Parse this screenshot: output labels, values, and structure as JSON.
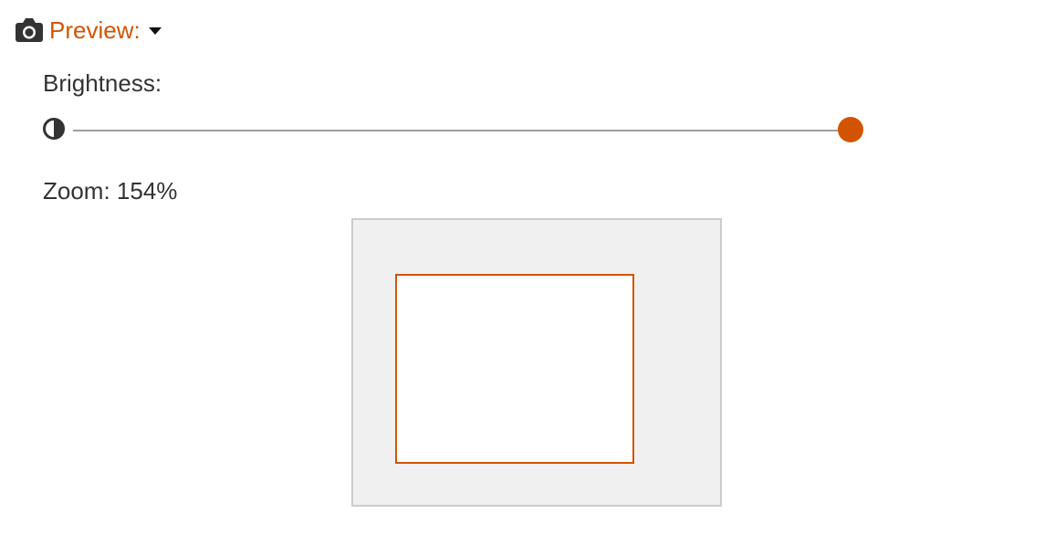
{
  "preview": {
    "label": "Preview:",
    "icon": "camera-icon",
    "toggle_icon": "caret-down-icon"
  },
  "brightness": {
    "label": "Brightness:",
    "icon": "contrast-icon",
    "value_fraction": 1.0
  },
  "zoom": {
    "label": "Zoom:",
    "value": "154%"
  },
  "colors": {
    "accent": "#d35400",
    "text": "#333333",
    "preview_background": "#f0f0f0",
    "preview_border": "#cccccc",
    "track": "#9e9e9e"
  }
}
